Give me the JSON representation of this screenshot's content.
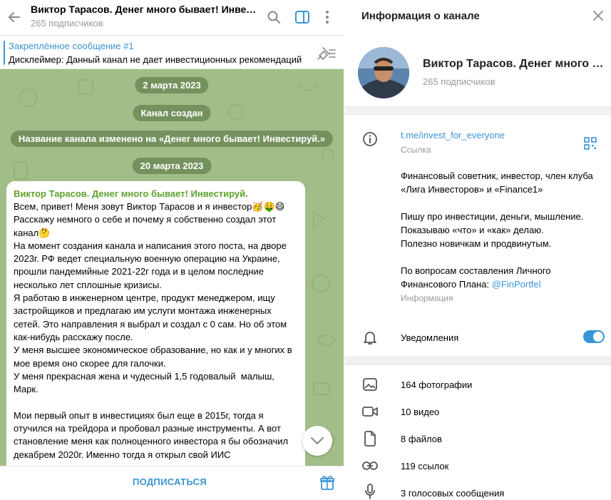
{
  "chat": {
    "title": "Виктор Тарасов. Денег много бывает! Инвестируй.",
    "subscribers": "265 подписчиков",
    "pinned": {
      "title": "Закреплённое сообщение #1",
      "text": "Дисклеймер: Данный канал не дает инвестиционных рекомендаций"
    },
    "service_messages": [
      "2 марта 2023",
      "Канал создан",
      "Название канала изменено на «Денег много бывает! Инвестируй.»",
      "20 марта 2023"
    ],
    "message": {
      "author": "Виктор Тарасов. Денег много бывает! Инвестируй.",
      "body": "Всем, привет! Меня зовут Виктор Тарасов и я инвестор🥳🤑😄\nРасскажу немного о себе и почему я собственно создал этот канал🤔\nНа момент создания канала и написания этого поста, на дворе 2023г. РФ ведет специальную военную операцию на Украине, прошли пандемийные 2021-22г года и в целом последние несколько лет сплошные кризисы.\nЯ работаю в инженерном центре, продукт менеджером, ищу застройщиков и предлагаю им услуги монтажа инженерных сетей. Это направления я выбрал и создал с 0 сам. Но об этом как-нибудь расскажу после.\nУ меня высшее экономическое образование, но как и у многих в мое время оно скорее для галочки.\nУ меня прекрасная жена и чудесный 1,5 годовалый  малыш, Марк.\n\nМои первый опыт в инвестициях был еще в 2015г, тогда я отучился на трейдора и пробовал разные инструменты. А вот становление меня как полноценного инвестора я бы обозначил декабрем 2020г. Именно тогда я открыл свой ИИС"
    },
    "subscribe_label": "ПОДПИСАТЬСЯ"
  },
  "info": {
    "header_title": "Информация о канале",
    "channel_name": "Виктор Тарасов. Денег много бывает! Инвестируй.",
    "subscribers": "265 подписчиков",
    "link": "t.me/invest_for_everyone",
    "link_label": "Ссылка",
    "description_1": "Финансовый советник, инвестор, член клуба «Лига Инвесторов» и «Finance1»\n\nПишу про инвестиции, деньги, мышление. Показываю «что» и «как» делаю.\nПолезно новичкам и продвинутым.\n\nПо вопросам составления Личного Финансового Плана: ",
    "description_mention": "@FinPortfel",
    "description_label": "Информация",
    "notifications_label": "Уведомления",
    "notifications_on": true,
    "media": [
      {
        "icon": "photo-icon",
        "label": "164 фотографии"
      },
      {
        "icon": "video-icon",
        "label": "10 видео"
      },
      {
        "icon": "file-icon",
        "label": "8 файлов"
      },
      {
        "icon": "link-icon",
        "label": "119 ссылок"
      },
      {
        "icon": "microphone-icon",
        "label": "3 голосовых сообщения"
      }
    ]
  },
  "colors": {
    "accent": "#3a95d5",
    "author": "#5ea12d",
    "chat_background": "#a2be88"
  }
}
